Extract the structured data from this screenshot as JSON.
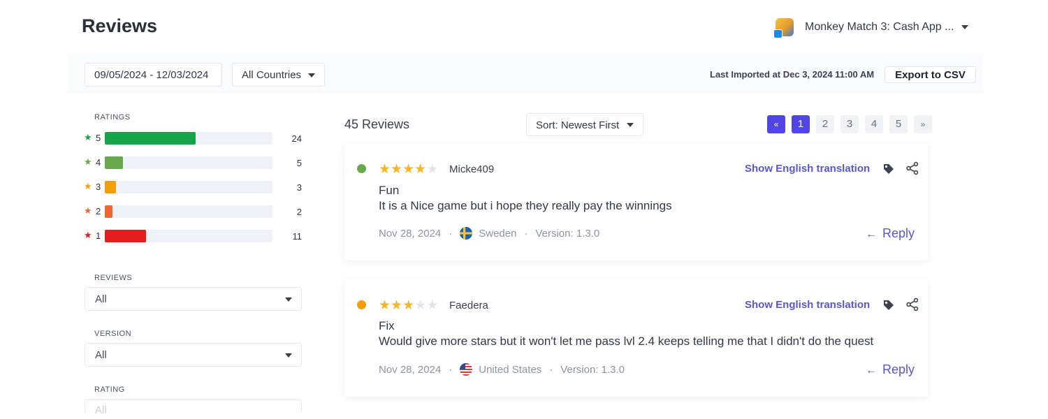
{
  "header": {
    "title": "Reviews",
    "app_name": "Monkey Match 3: Cash App ..."
  },
  "filters": {
    "date_range": "09/05/2024 - 12/03/2024",
    "country": "All Countries",
    "last_imported": "Last Imported at Dec 3, 2024 11:00 AM",
    "export_label": "Export to CSV"
  },
  "sidebar": {
    "ratings_label": "RATINGS",
    "ratings": [
      {
        "stars": "5",
        "count": "24",
        "fraction": 0.54,
        "color": "#16a34a"
      },
      {
        "stars": "4",
        "count": "5",
        "fraction": 0.11,
        "color": "#6aa84f"
      },
      {
        "stars": "3",
        "count": "3",
        "fraction": 0.065,
        "color": "#f59e0b"
      },
      {
        "stars": "2",
        "count": "2",
        "fraction": 0.045,
        "color": "#f0642d"
      },
      {
        "stars": "1",
        "count": "11",
        "fraction": 0.245,
        "color": "#e11d1d"
      }
    ],
    "star_glyph": "★",
    "reviews_label": "REVIEWS",
    "reviews_value": "All",
    "version_label": "VERSION",
    "version_value": "All",
    "rating_label": "RATING",
    "rating_value": "All"
  },
  "list": {
    "count_text": "45 Reviews",
    "sort": "Sort: Newest First",
    "pagination": {
      "first": "«",
      "pages": [
        "1",
        "2",
        "3",
        "4",
        "5"
      ],
      "current": "1",
      "next": "»"
    }
  },
  "reviews": [
    {
      "status_color": "#6aa84f",
      "rating": 4,
      "author": "Micke409",
      "translate_label": "Show English translation",
      "title": "Fun",
      "body": "It is a Nice game but i hope they really pay the winnings",
      "date": "Nov 28, 2024",
      "country": "Sweden",
      "version": "Version: 1.3.0",
      "reply_label": "Reply"
    },
    {
      "status_color": "#f59e0b",
      "rating": 3,
      "author": "Faedera",
      "translate_label": "Show English translation",
      "title": "Fix",
      "body": "Would give more stars but it won't let me pass lvl 2.4 keeps telling me that I didn't do the quest",
      "date": "Nov 28, 2024",
      "country": "United States",
      "version": "Version: 1.3.0",
      "reply_label": "Reply"
    }
  ],
  "colors": {
    "accent": "#4f46e5",
    "link": "#5a55d6",
    "star_on": "#f4b528",
    "star_off": "#e3e5ea"
  },
  "icons": {
    "tag": "tag-icon",
    "share": "share-icon",
    "reply_arrow": "arrow-left-icon",
    "caret": "chevron-down-icon"
  }
}
